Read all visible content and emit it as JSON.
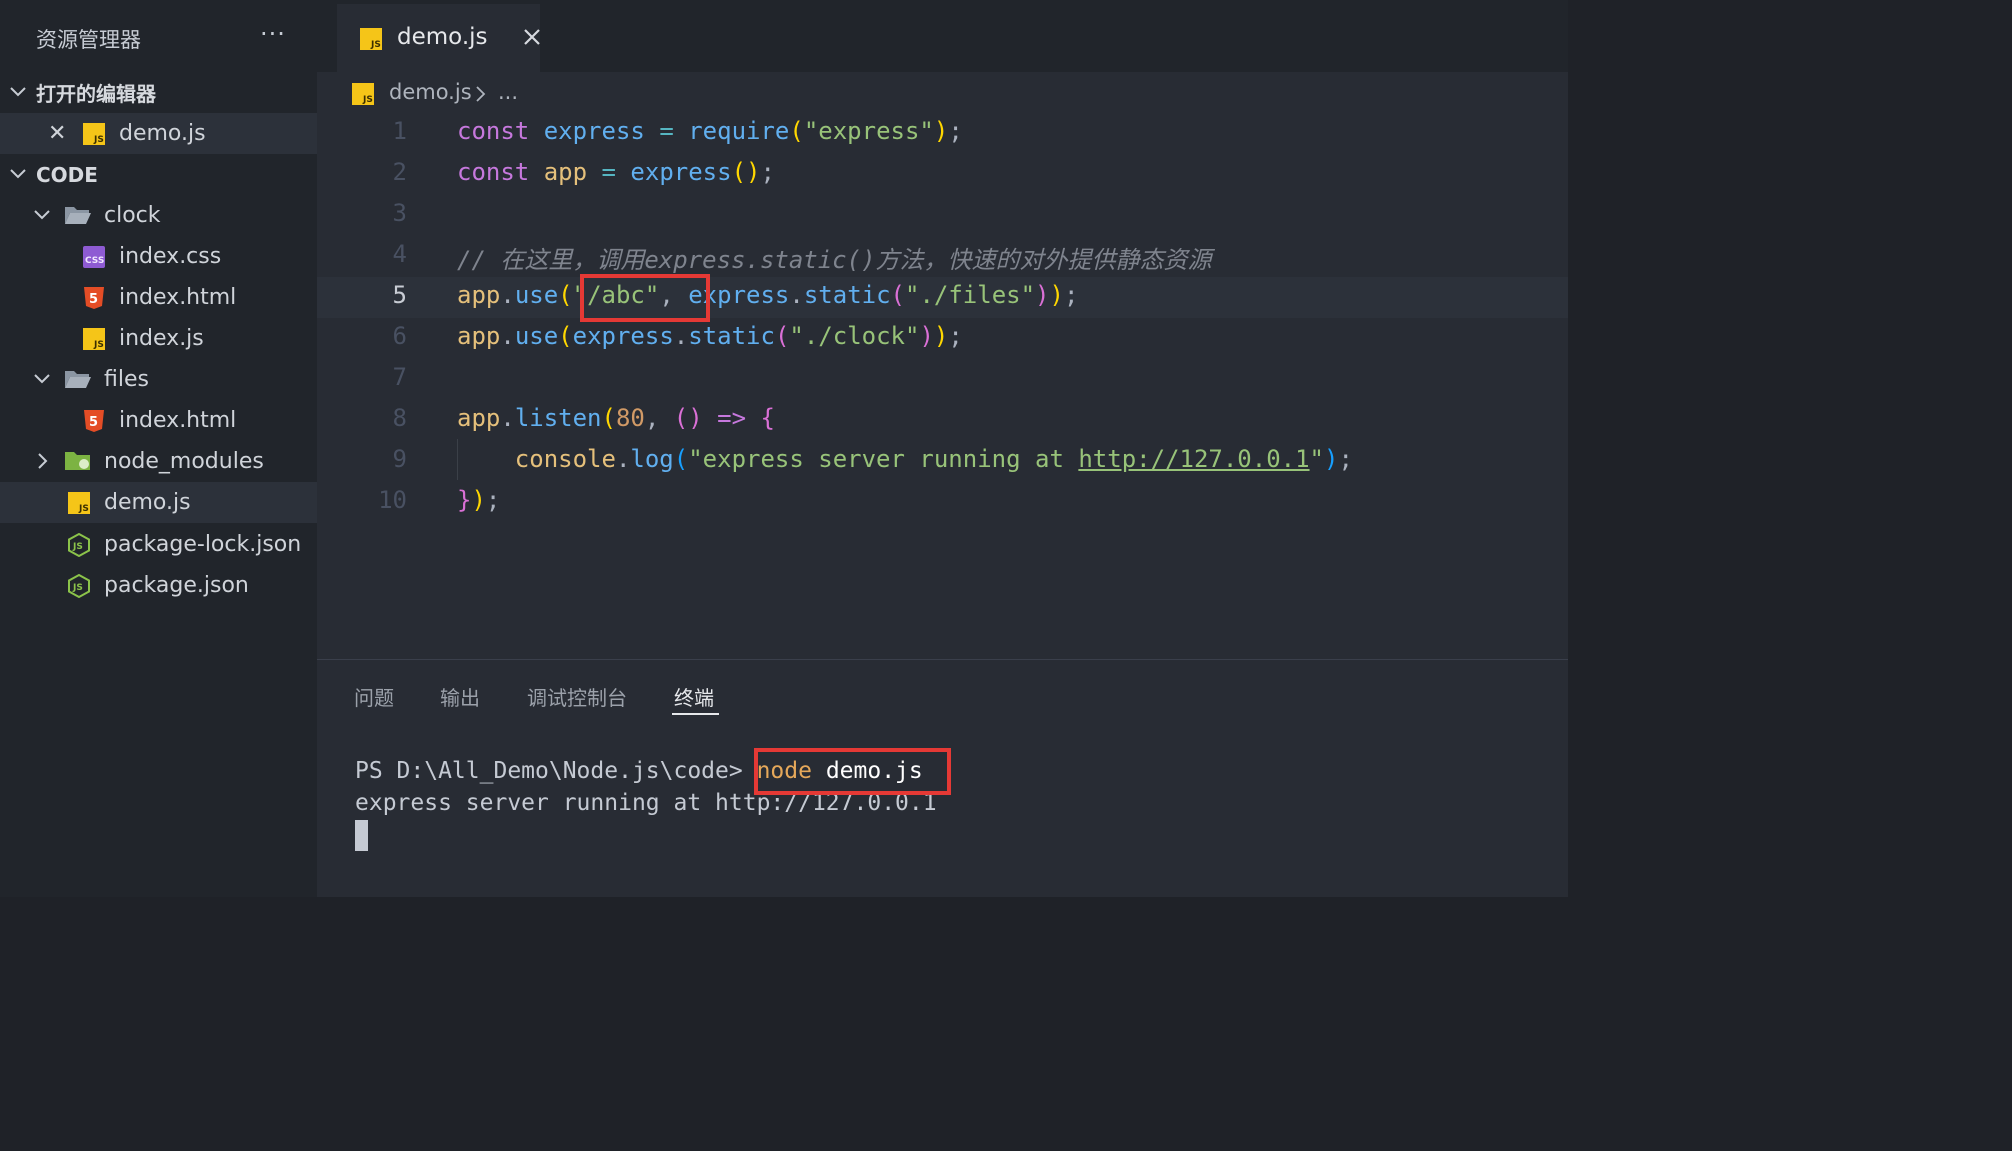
{
  "sidebar": {
    "title": "资源管理器",
    "more": "···",
    "open_editors": {
      "label": "打开的编辑器",
      "items": [
        {
          "close": "✕",
          "name": "demo.js",
          "icon": "js-file-icon"
        }
      ]
    },
    "workspace": {
      "label": "CODE",
      "folders": [
        {
          "name": "clock",
          "expanded": true,
          "files": [
            {
              "name": "index.css",
              "icon": "css-file-icon"
            },
            {
              "name": "index.html",
              "icon": "html-file-icon"
            },
            {
              "name": "index.js",
              "icon": "js-file-icon"
            }
          ]
        },
        {
          "name": "files",
          "expanded": true,
          "files": [
            {
              "name": "index.html",
              "icon": "html-file-icon"
            }
          ]
        },
        {
          "name": "node_modules",
          "expanded": false,
          "files": []
        }
      ],
      "files": [
        {
          "name": "demo.js",
          "icon": "js-file-icon",
          "selected": true
        },
        {
          "name": "package-lock.json",
          "icon": "nodejs-file-icon"
        },
        {
          "name": "package.json",
          "icon": "nodejs-file-icon"
        }
      ]
    }
  },
  "tab": {
    "label": "demo.js",
    "close": "✕"
  },
  "breadcrumb": {
    "file": "demo.js",
    "more": "..."
  },
  "editor": {
    "current_line": 5,
    "lines": [
      {
        "number": "1",
        "tokens": [
          [
            "kw",
            "const"
          ],
          [
            "pl",
            " "
          ],
          [
            "fn",
            "express"
          ],
          [
            "pl",
            " "
          ],
          [
            "op",
            "="
          ],
          [
            "pl",
            " "
          ],
          [
            "fn",
            "require"
          ],
          [
            "b1",
            "("
          ],
          [
            "str",
            "\"express\""
          ],
          [
            "b1",
            ")"
          ],
          [
            "pl",
            ";"
          ]
        ]
      },
      {
        "number": "2",
        "tokens": [
          [
            "kw",
            "const"
          ],
          [
            "pl",
            " "
          ],
          [
            "var",
            "app"
          ],
          [
            "pl",
            " "
          ],
          [
            "op",
            "="
          ],
          [
            "pl",
            " "
          ],
          [
            "fn",
            "express"
          ],
          [
            "b1",
            "()"
          ],
          [
            "pl",
            ";"
          ]
        ]
      },
      {
        "number": "3",
        "tokens": []
      },
      {
        "number": "4",
        "tokens": [
          [
            "cm",
            "// 在这里，调用express.static()方法，快速的对外提供静态资源"
          ]
        ]
      },
      {
        "number": "5",
        "tokens": [
          [
            "var",
            "app"
          ],
          [
            "pl",
            "."
          ],
          [
            "fn",
            "use"
          ],
          [
            "b1",
            "("
          ],
          [
            "str",
            "\"/abc\""
          ],
          [
            "pl",
            ", "
          ],
          [
            "fn",
            "express"
          ],
          [
            "pl",
            "."
          ],
          [
            "fn",
            "static"
          ],
          [
            "b2",
            "("
          ],
          [
            "str",
            "\"./files\""
          ],
          [
            "b2",
            ")"
          ],
          [
            "b1",
            ")"
          ],
          [
            "pl",
            ";"
          ]
        ]
      },
      {
        "number": "6",
        "tokens": [
          [
            "var",
            "app"
          ],
          [
            "pl",
            "."
          ],
          [
            "fn",
            "use"
          ],
          [
            "b1",
            "("
          ],
          [
            "fn",
            "express"
          ],
          [
            "pl",
            "."
          ],
          [
            "fn",
            "static"
          ],
          [
            "b2",
            "("
          ],
          [
            "str",
            "\"./clock\""
          ],
          [
            "b2",
            ")"
          ],
          [
            "b1",
            ")"
          ],
          [
            "pl",
            ";"
          ]
        ]
      },
      {
        "number": "7",
        "tokens": []
      },
      {
        "number": "8",
        "tokens": [
          [
            "var",
            "app"
          ],
          [
            "pl",
            "."
          ],
          [
            "fn",
            "listen"
          ],
          [
            "b1",
            "("
          ],
          [
            "num",
            "80"
          ],
          [
            "pl",
            ", "
          ],
          [
            "b2",
            "()"
          ],
          [
            "pl",
            " "
          ],
          [
            "kw",
            "=>"
          ],
          [
            "pl",
            " "
          ],
          [
            "b2",
            "{"
          ]
        ]
      },
      {
        "number": "9",
        "tokens": [
          [
            "pl",
            "    "
          ],
          [
            "var",
            "console"
          ],
          [
            "pl",
            "."
          ],
          [
            "fn",
            "log"
          ],
          [
            "b3",
            "("
          ],
          [
            "str",
            "\"express server running at "
          ],
          [
            "link",
            "http://127.0.0.1"
          ],
          [
            "str",
            "\""
          ],
          [
            "b3",
            ")"
          ],
          [
            "pl",
            ";"
          ]
        ]
      },
      {
        "number": "10",
        "tokens": [
          [
            "b2",
            "}"
          ],
          [
            "b1",
            ")"
          ],
          [
            "pl",
            ";"
          ]
        ]
      }
    ]
  },
  "panel": {
    "tabs": [
      "问题",
      "输出",
      "调试控制台",
      "终端"
    ],
    "active_tab": "终端",
    "terminal": {
      "prompt": "PS D:\\All_Demo\\Node.js\\code> ",
      "command": "node",
      "argument": " demo.js",
      "output": "express server running at http://127.0.0.1"
    }
  },
  "colors": {
    "highlight_box": "#e53935",
    "sidebar_bg": "#21252b",
    "editor_bg": "#282c34"
  }
}
